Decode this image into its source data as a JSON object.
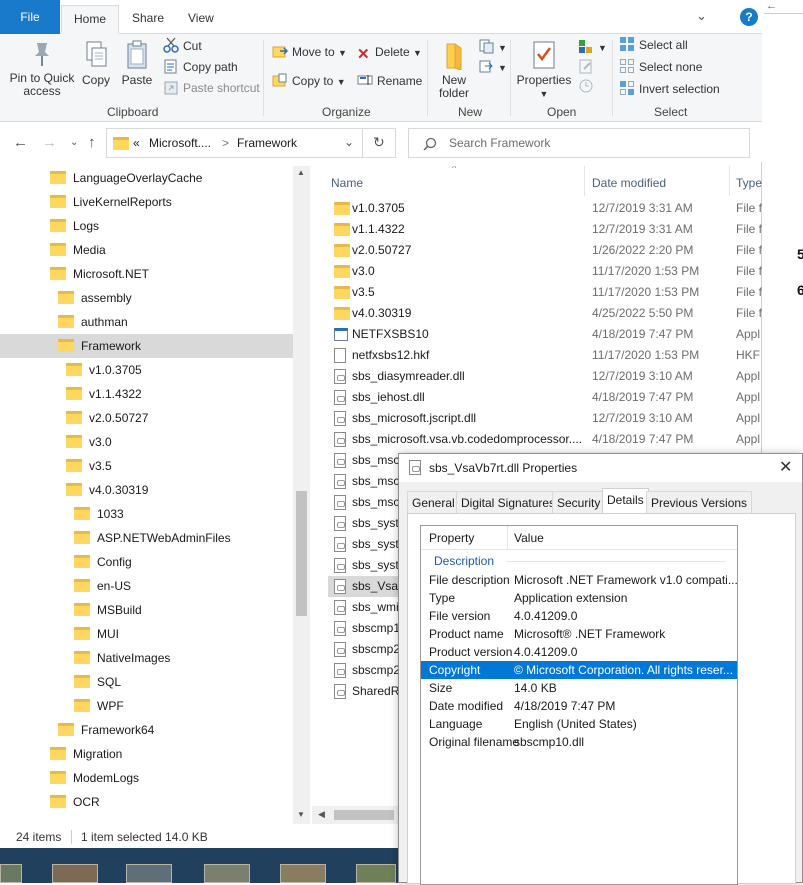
{
  "ribbon_tabs": {
    "file": "File",
    "home": "Home",
    "share": "Share",
    "view": "View"
  },
  "ribbon": {
    "pin_quick_access": "Pin to Quick access",
    "copy": "Copy",
    "paste": "Paste",
    "cut": "Cut",
    "copy_path": "Copy path",
    "paste_shortcut": "Paste shortcut",
    "clipboard_label": "Clipboard",
    "move_to": "Move to",
    "copy_to": "Copy to",
    "delete": "Delete",
    "rename": "Rename",
    "organize_label": "Organize",
    "new_folder": "New folder",
    "new_label": "New",
    "properties": "Properties",
    "open_label": "Open",
    "select_all": "Select all",
    "select_none": "Select none",
    "invert_selection": "Invert selection",
    "select_label": "Select"
  },
  "address": {
    "crumb_prefix": "«",
    "crumb1": "Microsoft....",
    "crumb_sep": ">",
    "crumb2": "Framework"
  },
  "search": {
    "placeholder": "Search Framework"
  },
  "nav_items": [
    {
      "label": "LanguageOverlayCache",
      "indent": 0
    },
    {
      "label": "LiveKernelReports",
      "indent": 0
    },
    {
      "label": "Logs",
      "indent": 0
    },
    {
      "label": "Media",
      "indent": 0
    },
    {
      "label": "Microsoft.NET",
      "indent": 0
    },
    {
      "label": "assembly",
      "indent": 1
    },
    {
      "label": "authman",
      "indent": 1
    },
    {
      "label": "Framework",
      "indent": 1,
      "selected": true
    },
    {
      "label": "v1.0.3705",
      "indent": 2
    },
    {
      "label": "v1.1.4322",
      "indent": 2
    },
    {
      "label": "v2.0.50727",
      "indent": 2
    },
    {
      "label": "v3.0",
      "indent": 2
    },
    {
      "label": "v3.5",
      "indent": 2
    },
    {
      "label": "v4.0.30319",
      "indent": 2
    },
    {
      "label": "1033",
      "indent": 3
    },
    {
      "label": "ASP.NETWebAdminFiles",
      "indent": 3
    },
    {
      "label": "Config",
      "indent": 3
    },
    {
      "label": "en-US",
      "indent": 3
    },
    {
      "label": "MSBuild",
      "indent": 3
    },
    {
      "label": "MUI",
      "indent": 3
    },
    {
      "label": "NativeImages",
      "indent": 3
    },
    {
      "label": "SQL",
      "indent": 3
    },
    {
      "label": "WPF",
      "indent": 3
    },
    {
      "label": "Framework64",
      "indent": 1
    },
    {
      "label": "Migration",
      "indent": 0
    },
    {
      "label": "ModemLogs",
      "indent": 0
    },
    {
      "label": "OCR",
      "indent": 0
    }
  ],
  "columns": {
    "name": "Name",
    "date": "Date modified",
    "type": "Type"
  },
  "files": [
    {
      "name": "v1.0.3705",
      "date": "12/7/2019 3:31 AM",
      "type": "File f",
      "icon": "folder"
    },
    {
      "name": "v1.1.4322",
      "date": "12/7/2019 3:31 AM",
      "type": "File f",
      "icon": "folder"
    },
    {
      "name": "v2.0.50727",
      "date": "1/26/2022 2:20 PM",
      "type": "File f",
      "icon": "folder"
    },
    {
      "name": "v3.0",
      "date": "11/17/2020 1:53 PM",
      "type": "File f",
      "icon": "folder"
    },
    {
      "name": "v3.5",
      "date": "11/17/2020 1:53 PM",
      "type": "File f",
      "icon": "folder"
    },
    {
      "name": "v4.0.30319",
      "date": "4/25/2022 5:50 PM",
      "type": "File f",
      "icon": "folder"
    },
    {
      "name": "NETFXSBS10",
      "date": "4/18/2019 7:47 PM",
      "type": "Appl",
      "icon": "app"
    },
    {
      "name": "netfxsbs12.hkf",
      "date": "11/17/2020 1:53 PM",
      "type": "HKF",
      "icon": "file"
    },
    {
      "name": "sbs_diasymreader.dll",
      "date": "12/7/2019 3:10 AM",
      "type": "Appl",
      "icon": "dll"
    },
    {
      "name": "sbs_iehost.dll",
      "date": "4/18/2019 7:47 PM",
      "type": "Appl",
      "icon": "dll"
    },
    {
      "name": "sbs_microsoft.jscript.dll",
      "date": "12/7/2019 3:10 AM",
      "type": "Appl",
      "icon": "dll"
    },
    {
      "name": "sbs_microsoft.vsa.vb.codedomprocessor....",
      "date": "4/18/2019 7:47 PM",
      "type": "Appl",
      "icon": "dll"
    },
    {
      "name": "sbs_msco",
      "date": "",
      "type": "",
      "icon": "dll"
    },
    {
      "name": "sbs_msco",
      "date": "",
      "type": "",
      "icon": "dll"
    },
    {
      "name": "sbs_msco",
      "date": "",
      "type": "",
      "icon": "dll"
    },
    {
      "name": "sbs_syste",
      "date": "",
      "type": "",
      "icon": "dll"
    },
    {
      "name": "sbs_syste",
      "date": "",
      "type": "",
      "icon": "dll"
    },
    {
      "name": "sbs_syste",
      "date": "",
      "type": "",
      "icon": "dll"
    },
    {
      "name": "sbs_VsaV",
      "date": "",
      "type": "",
      "icon": "dll",
      "selected": true
    },
    {
      "name": "sbs_wmi",
      "date": "",
      "type": "",
      "icon": "dll"
    },
    {
      "name": "sbscmp1",
      "date": "",
      "type": "",
      "icon": "dll"
    },
    {
      "name": "sbscmp2",
      "date": "",
      "type": "",
      "icon": "dll"
    },
    {
      "name": "sbscmp2",
      "date": "",
      "type": "",
      "icon": "dll"
    },
    {
      "name": "SharedRe",
      "date": "",
      "type": "",
      "icon": "dll"
    }
  ],
  "status": {
    "items": "24 items",
    "selected": "1 item selected  14.0 KB"
  },
  "edge_text": {
    "a": "5",
    "b": "6"
  },
  "props": {
    "title": "sbs_VsaVb7rt.dll Properties",
    "tabs": [
      "General",
      "Digital Signatures",
      "Security",
      "Details",
      "Previous Versions"
    ],
    "header_property": "Property",
    "header_value": "Value",
    "section": "Description",
    "rows": [
      {
        "k": "File description",
        "v": "Microsoft .NET Framework v1.0 compati..."
      },
      {
        "k": "Type",
        "v": "Application extension"
      },
      {
        "k": "File version",
        "v": "4.0.41209.0"
      },
      {
        "k": "Product name",
        "v": "Microsoft® .NET Framework"
      },
      {
        "k": "Product version",
        "v": "4.0.41209.0"
      },
      {
        "k": "Copyright",
        "v": "© Microsoft Corporation.  All rights reser...",
        "selected": true
      },
      {
        "k": "Size",
        "v": "14.0 KB"
      },
      {
        "k": "Date modified",
        "v": "4/18/2019 7:47 PM"
      },
      {
        "k": "Language",
        "v": "English (United States)"
      },
      {
        "k": "Original filename",
        "v": "sbscmp10.dll"
      }
    ]
  },
  "colors": {
    "accent": "#1979ca",
    "selection": "#0078d7",
    "folder": "#ffd75e",
    "taskbar": "#20405e"
  }
}
